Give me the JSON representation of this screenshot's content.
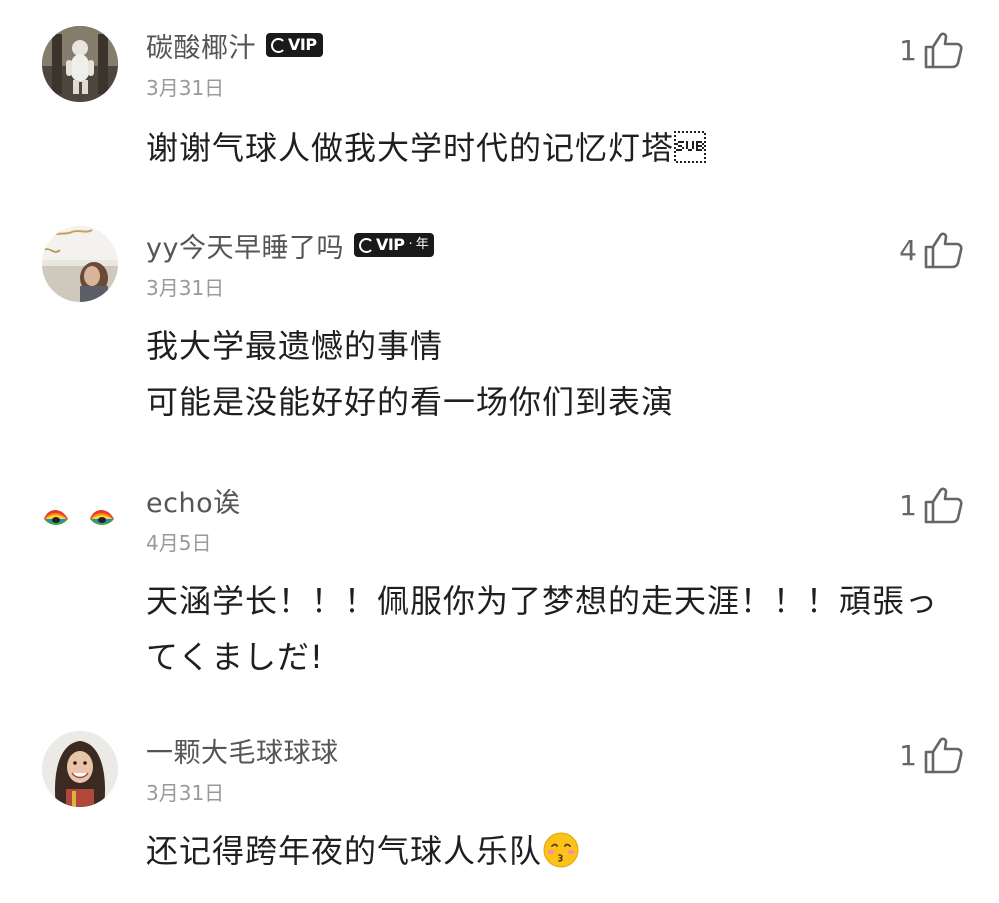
{
  "comments": [
    {
      "username": "碳酸椰汁",
      "vip": "VIP",
      "vip_suffix": "",
      "date": "3月31日",
      "likes": "1",
      "lines": [
        "谢谢气球人做我大学时代的记忆灯塔\u001a"
      ],
      "avatar_icon": "astronaut-photo-avatar"
    },
    {
      "username": "yy今天早睡了吗",
      "vip": "VIP",
      "vip_suffix": "· 年",
      "date": "3月31日",
      "likes": "4",
      "lines": [
        "我大学最遗憾的事情",
        "可能是没能好好的看一场你们到表演"
      ],
      "avatar_icon": "girl-photo-avatar"
    },
    {
      "username": "echo诶",
      "vip": "",
      "vip_suffix": "",
      "date": "4月5日",
      "likes": "1",
      "lines": [
        "天涵学长！！！佩服你为了梦想的走天涯！！！頑張っ",
        "てくましだ!"
      ],
      "avatar_icon": "rainbow-eyes-avatar"
    },
    {
      "username": "一颗大毛球球球",
      "vip": "",
      "vip_suffix": "",
      "date": "3月31日",
      "likes": "1",
      "lines": [
        "还记得跨年夜的气球人乐队"
      ],
      "trailing_emoji": "kissing-face-emoji",
      "avatar_icon": "smiling-woman-avatar"
    }
  ],
  "icons": {
    "like": "thumbs-up-outline-icon"
  },
  "colors": {
    "username": "#555555",
    "date": "#999999",
    "text": "#1f1f1f",
    "vip_badge": "#1a1a1a"
  }
}
